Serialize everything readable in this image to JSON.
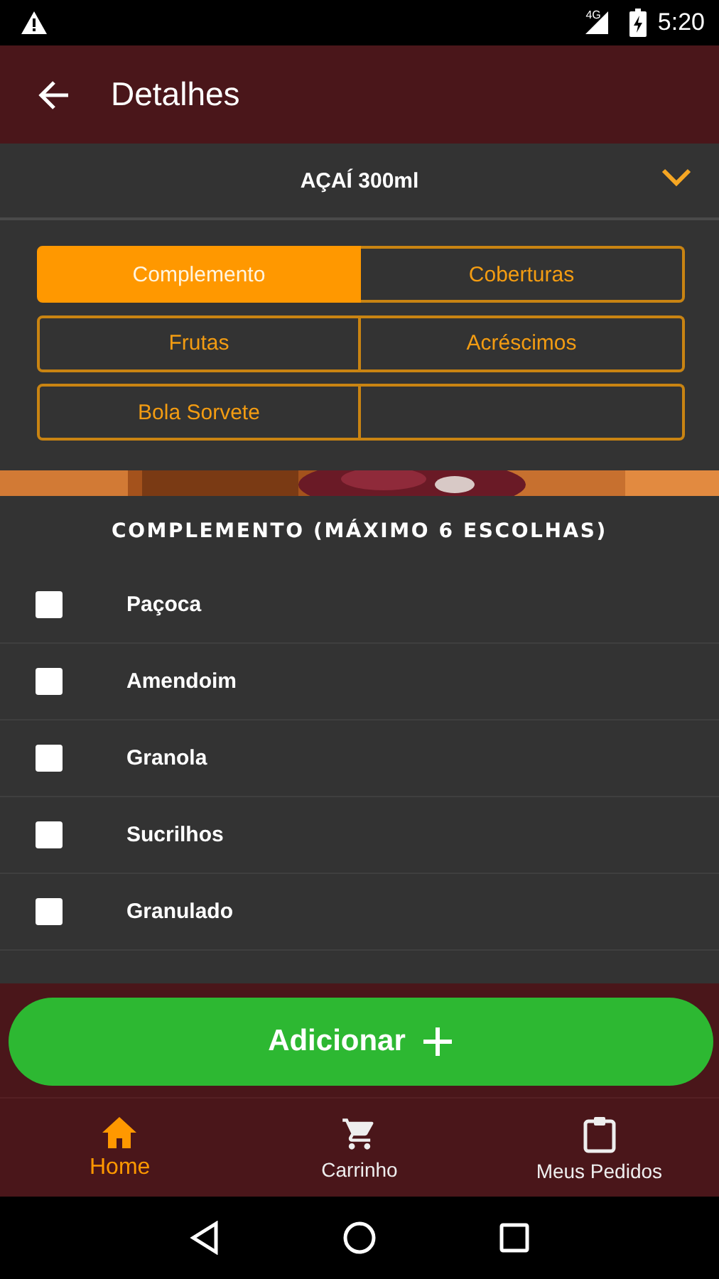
{
  "status_bar": {
    "time": "5:20",
    "network": "4G"
  },
  "app_bar": {
    "title": "Detalhes"
  },
  "product": {
    "name": "AÇAÍ 300ml",
    "expanded": false
  },
  "tabs": [
    {
      "label": "Complemento",
      "selected": true
    },
    {
      "label": "Coberturas",
      "selected": false
    },
    {
      "label": "Frutas",
      "selected": false
    },
    {
      "label": "Acréscimos",
      "selected": false
    },
    {
      "label": "Bola Sorvete",
      "selected": false
    }
  ],
  "section_title": "COMPLEMENTO (MÁXIMO 6 ESCOLHAS)",
  "options": [
    {
      "label": "Paçoca",
      "checked": false
    },
    {
      "label": "Amendoim",
      "checked": false
    },
    {
      "label": "Granola",
      "checked": false
    },
    {
      "label": "Sucrilhos",
      "checked": false
    },
    {
      "label": "Granulado",
      "checked": false
    }
  ],
  "add_button": {
    "label": "Adicionar"
  },
  "bottom_nav": [
    {
      "label": "Home",
      "selected": true
    },
    {
      "label": "Carrinho",
      "selected": false
    },
    {
      "label": "Meus Pedidos",
      "selected": false
    }
  ]
}
